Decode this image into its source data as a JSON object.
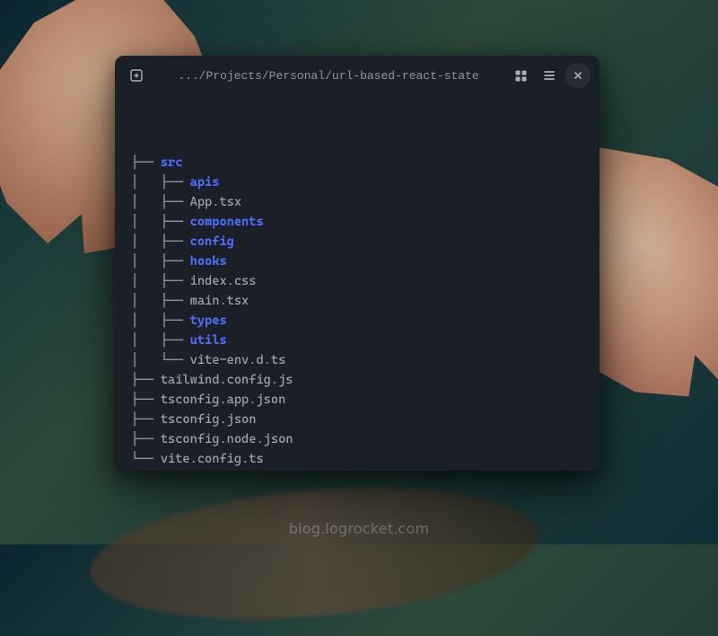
{
  "titlebar": {
    "title": ".../Projects/Personal/url-based-react-state"
  },
  "tree": [
    {
      "prefix": "├── ",
      "name": "src",
      "type": "dir"
    },
    {
      "prefix": "│   ├── ",
      "name": "apis",
      "type": "dir"
    },
    {
      "prefix": "│   ├── ",
      "name": "App.tsx",
      "type": "file"
    },
    {
      "prefix": "│   ├── ",
      "name": "components",
      "type": "dir"
    },
    {
      "prefix": "│   ├── ",
      "name": "config",
      "type": "dir"
    },
    {
      "prefix": "│   ├── ",
      "name": "hooks",
      "type": "dir"
    },
    {
      "prefix": "│   ├── ",
      "name": "index.css",
      "type": "file"
    },
    {
      "prefix": "│   ├── ",
      "name": "main.tsx",
      "type": "file"
    },
    {
      "prefix": "│   ├── ",
      "name": "types",
      "type": "dir"
    },
    {
      "prefix": "│   ├── ",
      "name": "utils",
      "type": "dir"
    },
    {
      "prefix": "│   └── ",
      "name": "vite-env.d.ts",
      "type": "file"
    },
    {
      "prefix": "├── ",
      "name": "tailwind.config.js",
      "type": "file"
    },
    {
      "prefix": "├── ",
      "name": "tsconfig.app.json",
      "type": "file"
    },
    {
      "prefix": "├── ",
      "name": "tsconfig.json",
      "type": "file"
    },
    {
      "prefix": "├── ",
      "name": "tsconfig.node.json",
      "type": "file"
    },
    {
      "prefix": "└── ",
      "name": "vite.config.ts",
      "type": "file"
    }
  ],
  "prompt": "$",
  "watermark": "blog.logrocket.com"
}
